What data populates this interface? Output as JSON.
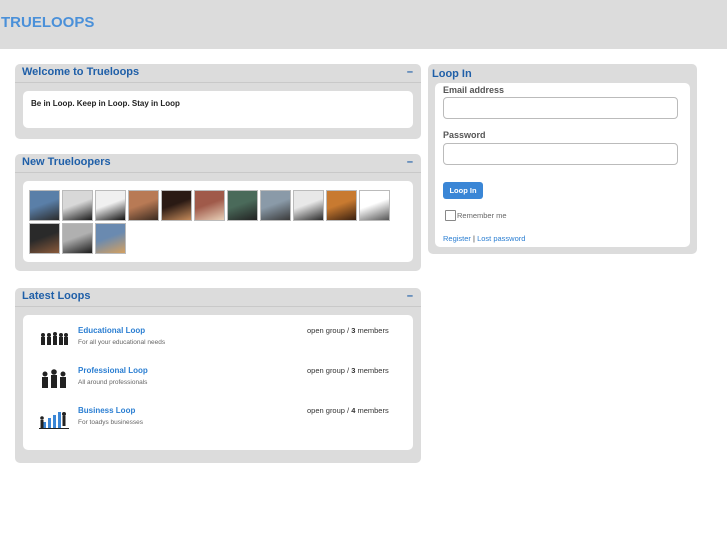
{
  "header": {
    "logo": "TRUELOOPS"
  },
  "welcome": {
    "title": "Welcome to Trueloops",
    "minimize": "–",
    "tagline": "Be in Loop. Keep in Loop. Stay in Loop"
  },
  "new_members": {
    "title": "New Trueloopers",
    "minimize": "–",
    "avatars": [
      {
        "colors": [
          "#5a7fa8",
          "#2b2b2b"
        ]
      },
      {
        "colors": [
          "#d8d8d8",
          "#1a1a1a"
        ]
      },
      {
        "colors": [
          "#f0f0f0",
          "#111111"
        ]
      },
      {
        "colors": [
          "#b87a55",
          "#3a2a20"
        ]
      },
      {
        "colors": [
          "#2a1a14",
          "#c48a5a"
        ]
      },
      {
        "colors": [
          "#a05a4a",
          "#e8d0b8"
        ]
      },
      {
        "colors": [
          "#4a6a5a",
          "#222222"
        ]
      },
      {
        "colors": [
          "#8a9aa8",
          "#3a3a3a"
        ]
      },
      {
        "colors": [
          "#e8e8e8",
          "#2a2a2a"
        ]
      },
      {
        "colors": [
          "#c87a30",
          "#3a2010"
        ]
      },
      {
        "colors": [
          "#ffffff",
          "#555555"
        ]
      },
      {
        "colors": [
          "#2a2a2a",
          "#8a5a3a"
        ]
      },
      {
        "colors": [
          "#b0b0b0",
          "#1a1a1a"
        ]
      },
      {
        "colors": [
          "#6a8ab0",
          "#d4a060"
        ]
      }
    ]
  },
  "latest_loops": {
    "title": "Latest Loops",
    "minimize": "–",
    "items": [
      {
        "name": "Educational Loop",
        "desc": "For all your educational needs",
        "group": "open group / ",
        "count": "3",
        "members": " members",
        "icon": "students-group-icon"
      },
      {
        "name": "Professional Loop",
        "desc": "All around professionals",
        "group": "open group / ",
        "count": "3",
        "members": " members",
        "icon": "professionals-group-icon"
      },
      {
        "name": "Business Loop",
        "desc": "For toadys businesses",
        "group": "open group / ",
        "count": "4",
        "members": " members",
        "icon": "business-chart-icon"
      }
    ]
  },
  "login": {
    "title": "Loop In",
    "email_label": "Email address",
    "email_value": "",
    "password_label": "Password",
    "password_value": "",
    "button": "Loop In",
    "remember": "Remember me",
    "register": "Register",
    "separator": " | ",
    "lost_password": "Lost password"
  }
}
